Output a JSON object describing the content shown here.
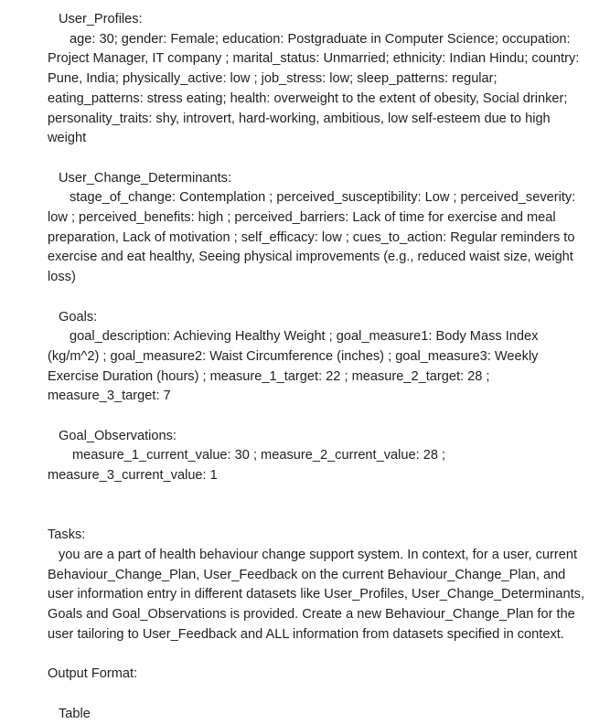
{
  "user_profiles": {
    "heading": "User_Profiles:",
    "text": "age: 30; gender: Female; education: Postgraduate in Computer Science; occupation: Project Manager, IT company ; marital_status: Unmarried; ethnicity: Indian Hindu; country: Pune, India; physically_active: low ; job_stress: low;  sleep_patterns: regular; eating_patterns: stress eating; health: overweight to the extent of obesity, Social drinker; personality_traits: shy, introvert, hard-working, ambitious,  low self-esteem due to high weight"
  },
  "user_change_determinants": {
    "heading": "User_Change_Determinants:",
    "text": "stage_of_change: Contemplation ; perceived_susceptibility: Low ; perceived_severity: low ; perceived_benefits: high ; perceived_barriers: Lack of time for exercise and meal preparation, Lack of motivation ; self_efficacy: low ; cues_to_action: Regular reminders to exercise and eat healthy, Seeing physical improvements (e.g., reduced waist size, weight loss)"
  },
  "goals": {
    "heading": "Goals:",
    "text": "goal_description: Achieving Healthy Weight ; goal_measure1: Body Mass Index (kg/m^2) ; goal_measure2: Waist Circumference (inches) ; goal_measure3: Weekly Exercise Duration (hours) ; measure_1_target: 22 ; measure_2_target: 28 ; measure_3_target: 7"
  },
  "goal_observations": {
    "heading": "Goal_Observations:",
    "text": "measure_1_current_value: 30 ; measure_2_current_value: 28 ; measure_3_current_value: 1"
  },
  "tasks": {
    "heading": "Tasks:",
    "text": "you are a part of health behaviour change support system. In context, for a user, current Behaviour_Change_Plan, User_Feedback on the current Behaviour_Change_Plan, and user information entry in different datasets like User_Profiles, User_Change_Determinants, Goals and Goal_Observations is provided. Create a new Behaviour_Change_Plan for the user tailoring to User_Feedback and ALL information from datasets specified in context."
  },
  "output_format": {
    "heading": "Output Format:",
    "value": "Table"
  }
}
